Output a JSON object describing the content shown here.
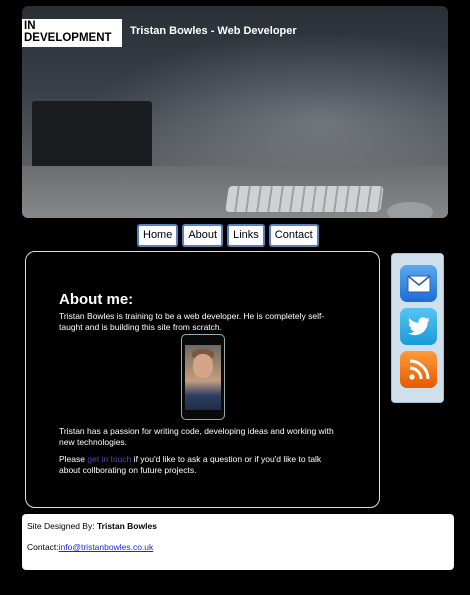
{
  "header": {
    "badge": "IN DEVELOPMENT",
    "title": "Tristan Bowles - Web Developer"
  },
  "nav": {
    "items": [
      {
        "label": "Home"
      },
      {
        "label": "About"
      },
      {
        "label": "Links"
      },
      {
        "label": "Contact"
      }
    ]
  },
  "about": {
    "heading": "About me:",
    "para1": "Tristan Bowles is training to be a web developer. He is completely self-taught and is building this site from scratch.",
    "para2": "Tristan has a passion for writing code, developing ideas and working with new technologies.",
    "para3_before": "Please ",
    "para3_link": "get in touch",
    "para3_after": " if you'd like to ask a question or if you'd like to talk about collborating on future projects."
  },
  "social": {
    "icons": [
      "mail-icon",
      "twitter-icon",
      "rss-icon"
    ]
  },
  "footer": {
    "designed_label": "Site Designed By: ",
    "designer": "Tristan Bowles",
    "contact_label": "Contact:",
    "email": "info@tristanbowles.co.uk"
  },
  "colors": {
    "background": "#000000",
    "nav_border": "#5b7fc0",
    "link": "#5a3ec8",
    "email_link": "#1a2bd0",
    "social_panel": "#cfe0ec"
  }
}
